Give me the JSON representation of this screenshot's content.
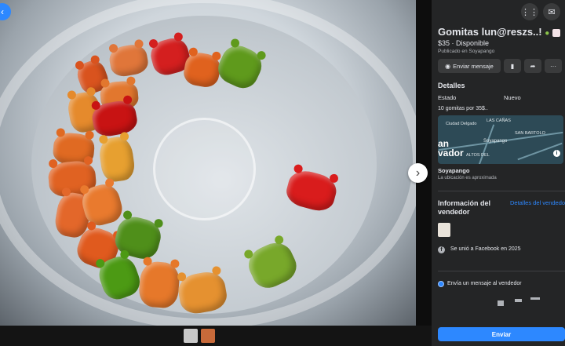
{
  "listing": {
    "title": "Gomitas lun@reszs..!",
    "price_status": "$35 · Disponible",
    "published": "Publicado en Soyapango",
    "title_emojis": [
      "alien-icon",
      "sticker-icon"
    ]
  },
  "actions": {
    "message_label": "Enviar mensaje",
    "icons": [
      "messenger-icon",
      "bookmark-icon",
      "share-icon",
      "more-icon"
    ]
  },
  "details": {
    "heading": "Detalles",
    "condition_label": "Estado",
    "condition_value": "Nuevo",
    "description": "10 gomitas por 35$.."
  },
  "map": {
    "label_ciudad_delgado": "Ciudad Delgado",
    "label_soyapango": "Soyapango",
    "label_las_canas": "LAS CAÑAS",
    "label_san_bartolo": "SAN BARTOLO",
    "label_altos": "ALTOS DEL",
    "partial_text": "an\nvador",
    "location_name": "Soyapango",
    "location_note": "La ubicación es aproximada"
  },
  "seller": {
    "heading_line1": "Información del",
    "heading_line2": "vendedor",
    "details_link": "Detalles del vendedor",
    "joined": "Se unió a Facebook en 2025"
  },
  "message": {
    "prompt": "Envía un mensaje al vendedor",
    "send_label": "Enviar"
  },
  "colors": {
    "accent": "#2d88ff",
    "panel_bg": "#242526",
    "button_bg": "#3a3b3c"
  }
}
